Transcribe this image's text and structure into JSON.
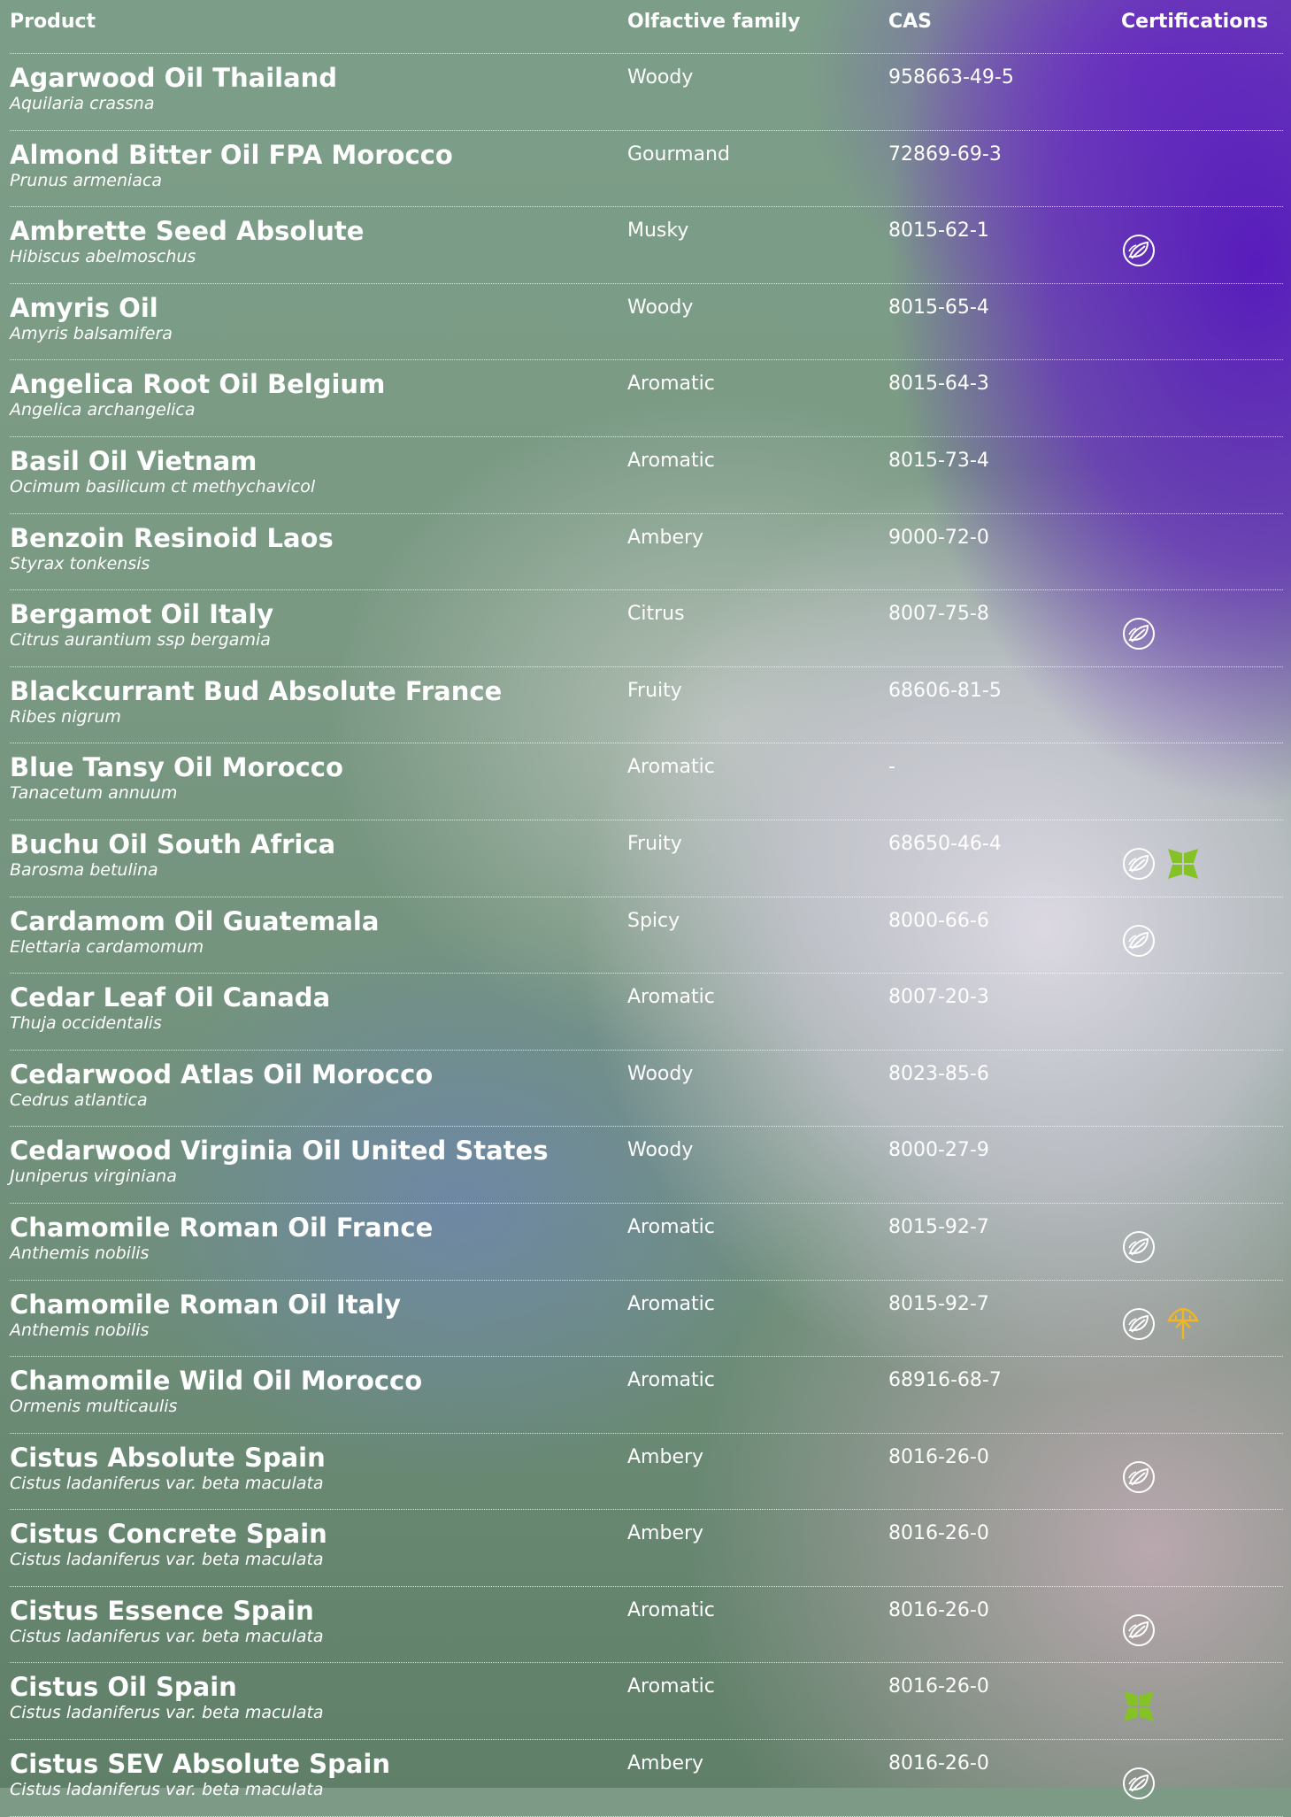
{
  "header": {
    "product": "Product",
    "family": "Olfactive family",
    "cas": "CAS",
    "certifications": "Certifications"
  },
  "colors": {
    "organic_icon": "#ffffff",
    "fair_trade_icon": "#84c225",
    "sustainable_icon": "#f0b625"
  },
  "rows": [
    {
      "name": "Agarwood Oil Thailand",
      "latin": "Aquilaria crassna",
      "family": "Woody",
      "cas": "958663-49-5",
      "certs": []
    },
    {
      "name": "Almond Bitter Oil FPA Morocco",
      "latin": "Prunus armeniaca",
      "family": "Gourmand",
      "cas": "72869-69-3",
      "certs": []
    },
    {
      "name": "Ambrette Seed Absolute",
      "latin": "Hibiscus abelmoschus",
      "family": "Musky",
      "cas": "8015-62-1",
      "certs": [
        "organic-leaf-icon"
      ]
    },
    {
      "name": "Amyris Oil",
      "latin": "Amyris balsamifera",
      "family": "Woody",
      "cas": "8015-65-4",
      "certs": []
    },
    {
      "name": "Angelica Root Oil Belgium",
      "latin": "Angelica archangelica",
      "family": "Aromatic",
      "cas": "8015-64-3",
      "certs": []
    },
    {
      "name": "Basil Oil Vietnam",
      "latin": "Ocimum basilicum ct methychavicol",
      "family": "Aromatic",
      "cas": "8015-73-4",
      "certs": []
    },
    {
      "name": "Benzoin Resinoid Laos",
      "latin": "Styrax tonkensis",
      "family": "Ambery",
      "cas": "9000-72-0",
      "certs": []
    },
    {
      "name": "Bergamot Oil Italy",
      "latin": "Citrus aurantium ssp bergamia",
      "family": "Citrus",
      "cas": "8007-75-8",
      "certs": [
        "organic-leaf-icon"
      ]
    },
    {
      "name": "Blackcurrant Bud Absolute France",
      "latin": "Ribes nigrum",
      "family": "Fruity",
      "cas": "68606-81-5",
      "certs": []
    },
    {
      "name": "Blue Tansy Oil Morocco",
      "latin": "Tanacetum annuum",
      "family": "Aromatic",
      "cas": "-",
      "certs": []
    },
    {
      "name": "Buchu Oil South Africa",
      "latin": "Barosma betulina",
      "family": "Fruity",
      "cas": "68650-46-4",
      "certs": [
        "organic-leaf-icon",
        "fair-trade-icon"
      ]
    },
    {
      "name": "Cardamom Oil Guatemala",
      "latin": "Elettaria cardamomum",
      "family": "Spicy",
      "cas": "8000-66-6",
      "certs": [
        "organic-leaf-icon"
      ]
    },
    {
      "name": "Cedar Leaf Oil Canada",
      "latin": "Thuja occidentalis",
      "family": "Aromatic",
      "cas": "8007-20-3",
      "certs": []
    },
    {
      "name": "Cedarwood Atlas Oil Morocco",
      "latin": "Cedrus atlantica",
      "family": "Woody",
      "cas": "8023-85-6",
      "certs": []
    },
    {
      "name": "Cedarwood Virginia Oil United States",
      "latin": "Juniperus virginiana",
      "family": "Woody",
      "cas": "8000-27-9",
      "certs": []
    },
    {
      "name": "Chamomile Roman Oil France",
      "latin": "Anthemis nobilis",
      "family": "Aromatic",
      "cas": "8015-92-7",
      "certs": [
        "organic-leaf-icon"
      ]
    },
    {
      "name": "Chamomile Roman Oil Italy",
      "latin": "Anthemis nobilis",
      "family": "Aromatic",
      "cas": "8015-92-7",
      "certs": [
        "organic-leaf-icon",
        "sustainable-tree-icon"
      ]
    },
    {
      "name": "Chamomile Wild Oil Morocco",
      "latin": "Ormenis multicaulis",
      "family": "Aromatic",
      "cas": "68916-68-7",
      "certs": []
    },
    {
      "name": "Cistus Absolute Spain",
      "latin": "Cistus ladaniferus var. beta maculata",
      "family": "Ambery",
      "cas": "8016-26-0",
      "certs": [
        "organic-leaf-icon"
      ]
    },
    {
      "name": "Cistus Concrete Spain",
      "latin": "Cistus ladaniferus var. beta maculata",
      "family": "Ambery",
      "cas": "8016-26-0",
      "certs": []
    },
    {
      "name": "Cistus Essence Spain",
      "latin": "Cistus ladaniferus var. beta maculata",
      "family": "Aromatic",
      "cas": "8016-26-0",
      "certs": [
        "organic-leaf-icon"
      ]
    },
    {
      "name": "Cistus Oil Spain",
      "latin": "Cistus ladaniferus var. beta maculata",
      "family": "Aromatic",
      "cas": "8016-26-0",
      "certs": [
        "fair-trade-icon"
      ]
    },
    {
      "name": "Cistus SEV Absolute Spain",
      "latin": "Cistus ladaniferus var. beta maculata",
      "family": "Ambery",
      "cas": "8016-26-0",
      "certs": [
        "organic-leaf-icon"
      ]
    }
  ]
}
